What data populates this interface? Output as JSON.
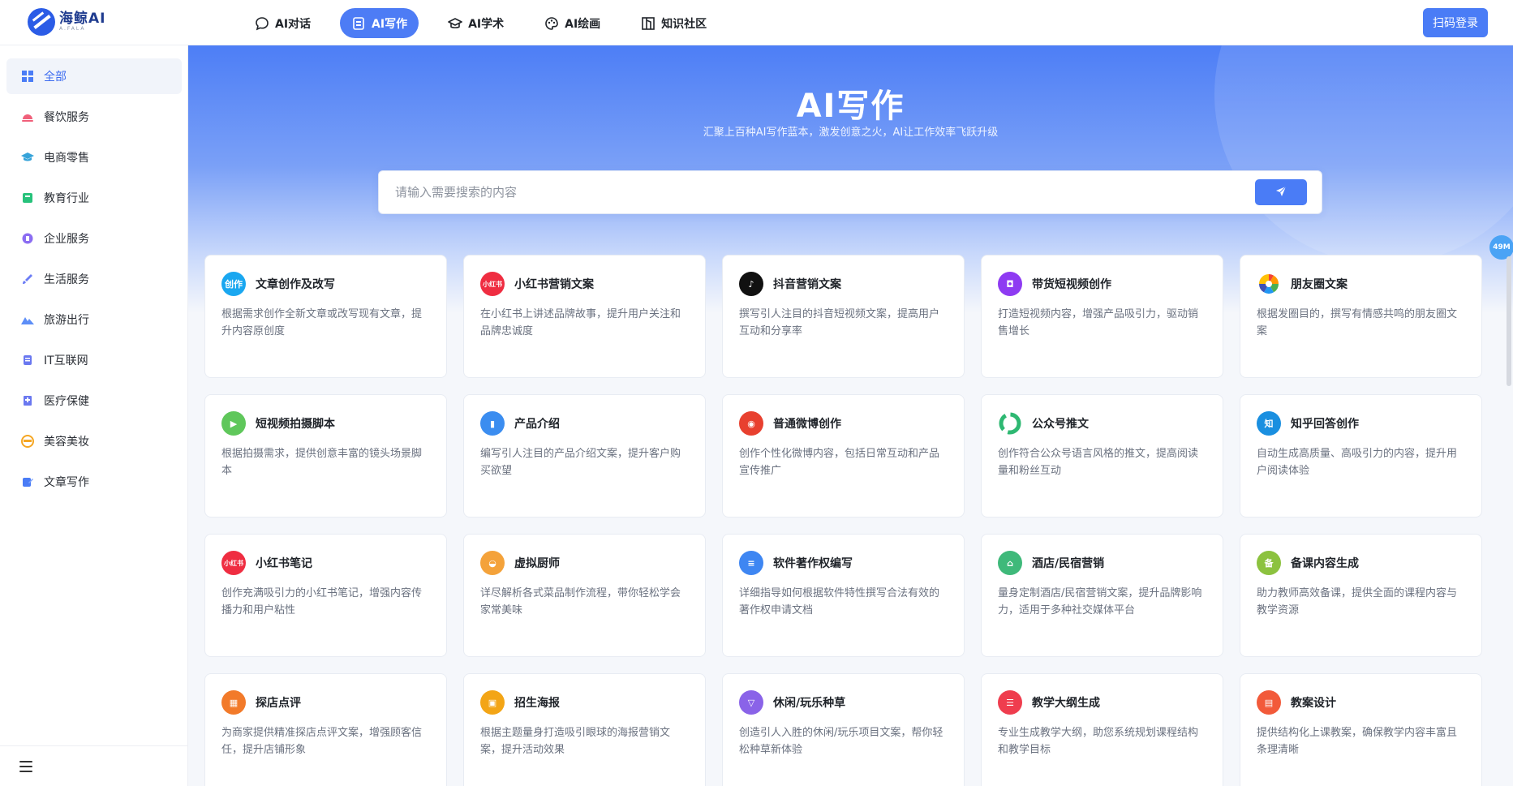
{
  "header": {
    "logo_name": "海鲸AI",
    "logo_sub": "A.FALA",
    "nav": [
      {
        "label": "AI对话",
        "icon": "chat-bubble-icon"
      },
      {
        "label": "AI写作",
        "icon": "document-edit-icon",
        "active": true
      },
      {
        "label": "AI学术",
        "icon": "graduation-cap-icon"
      },
      {
        "label": "AI绘画",
        "icon": "palette-icon"
      },
      {
        "label": "知识社区",
        "icon": "book-icon"
      }
    ],
    "login_label": "扫码登录"
  },
  "sidebar": {
    "items": [
      {
        "label": "全部",
        "icon": "windows-grid-icon",
        "color": "#4a7cf6",
        "active": true
      },
      {
        "label": "餐饮服务",
        "icon": "dining-icon",
        "color": "#f0607a"
      },
      {
        "label": "电商零售",
        "icon": "cap-icon",
        "color": "#36a3d9"
      },
      {
        "label": "教育行业",
        "icon": "book-icon",
        "color": "#27c27b"
      },
      {
        "label": "企业服务",
        "icon": "building-icon",
        "color": "#8b6df2"
      },
      {
        "label": "生活服务",
        "icon": "brush-icon",
        "color": "#6c7df5"
      },
      {
        "label": "旅游出行",
        "icon": "mountain-icon",
        "color": "#5d8ef7"
      },
      {
        "label": "IT互联网",
        "icon": "document-icon",
        "color": "#6a78f0"
      },
      {
        "label": "医疗保健",
        "icon": "clinic-icon",
        "color": "#6a78f0"
      },
      {
        "label": "美容美妆",
        "icon": "face-icon",
        "color": "#f5a623"
      },
      {
        "label": "文章写作",
        "icon": "pencil-note-icon",
        "color": "#4a7cf6"
      }
    ]
  },
  "hero": {
    "title": "AI写作",
    "subtitle": "汇聚上百种AI写作蓝本，激发创意之火，AI让工作效率飞跃升级"
  },
  "search": {
    "placeholder": "请输入需要搜索的内容"
  },
  "badge": "49M",
  "cards": [
    {
      "title": "文章创作及改写",
      "desc": "根据需求创作全新文章或改写现有文章，提升内容原创度",
      "icon": "creation-icon",
      "icon_text": "创作",
      "color": "#1aa7f0"
    },
    {
      "title": "小红书营销文案",
      "desc": "在小红书上讲述品牌故事，提升用户关注和品牌忠诚度",
      "icon": "xiaohongshu-icon",
      "icon_text": "小红书",
      "color": "#ef2d41"
    },
    {
      "title": "抖音营销文案",
      "desc": "撰写引人注目的抖音短视频文案，提高用户互动和分享率",
      "icon": "douyin-icon",
      "icon_text": "♪",
      "color": "#111111"
    },
    {
      "title": "带货短视频创作",
      "desc": "打造短视频内容，增强产品吸引力，驱动销售增长",
      "icon": "shopping-bag-icon",
      "icon_text": "◘",
      "color": "#8e3bf2"
    },
    {
      "title": "朋友圈文案",
      "desc": "根据发圈目的，撰写有情感共鸣的朋友圈文案",
      "icon": "moments-icon",
      "icon_text": "",
      "color": "#ffffff"
    },
    {
      "title": "短视频拍摄脚本",
      "desc": "根据拍摄需求，提供创意丰富的镜头场景脚本",
      "icon": "video-camera-icon",
      "icon_text": "▶",
      "color": "#5fc75b"
    },
    {
      "title": "产品介绍",
      "desc": "编写引人注目的产品介绍文案，提升客户购买欲望",
      "icon": "product-card-icon",
      "icon_text": "▮",
      "color": "#3b8df0"
    },
    {
      "title": "普通微博创作",
      "desc": "创作个性化微博内容，包括日常互动和产品宣传推广",
      "icon": "weibo-icon",
      "icon_text": "◉",
      "color": "#e8402f"
    },
    {
      "title": "公众号推文",
      "desc": "创作符合公众号语言风格的推文，提高阅读量和粉丝互动",
      "icon": "wechat-official-icon",
      "icon_text": "",
      "color": "#ffffff"
    },
    {
      "title": "知乎回答创作",
      "desc": "自动生成高质量、高吸引力的内容，提升用户阅读体验",
      "icon": "zhihu-icon",
      "icon_text": "知",
      "color": "#1a8fe0"
    },
    {
      "title": "小红书笔记",
      "desc": "创作充满吸引力的小红书笔记，增强内容传播力和用户粘性",
      "icon": "xiaohongshu-note-icon",
      "icon_text": "小红书",
      "color": "#ef2d41"
    },
    {
      "title": "虚拟厨师",
      "desc": "详尽解析各式菜品制作流程，带你轻松学会家常美味",
      "icon": "chef-icon",
      "icon_text": "◒",
      "color": "#f4a23a"
    },
    {
      "title": "软件著作权编写",
      "desc": "详细指导如何根据软件特性撰写合法有效的著作权申请文档",
      "icon": "copyright-doc-icon",
      "icon_text": "≡",
      "color": "#3e86f2"
    },
    {
      "title": "酒店/民宿营销",
      "desc": "量身定制酒店/民宿营销文案，提升品牌影响力，适用于多种社交媒体平台",
      "icon": "hotel-icon",
      "icon_text": "⌂",
      "color": "#3fb97a"
    },
    {
      "title": "备课内容生成",
      "desc": "助力教师高效备课，提供全面的课程内容与教学资源",
      "icon": "lesson-prep-icon",
      "icon_text": "备",
      "color": "#8cc23f"
    },
    {
      "title": "探店点评",
      "desc": "为商家提供精准探店点评文案，增强顾客信任，提升店铺形象",
      "icon": "store-review-icon",
      "icon_text": "▦",
      "color": "#f27a2a"
    },
    {
      "title": "招生海报",
      "desc": "根据主题量身打造吸引眼球的海报营销文案，提升活动效果",
      "icon": "poster-icon",
      "icon_text": "▣",
      "color": "#f3a516"
    },
    {
      "title": "休闲/玩乐种草",
      "desc": "创造引人入胜的休闲/玩乐项目文案，帮你轻松种草新体验",
      "icon": "cocktail-icon",
      "icon_text": "▽",
      "color": "#8a63e8"
    },
    {
      "title": "教学大纲生成",
      "desc": "专业生成教学大纲，助您系统规划课程结构和教学目标",
      "icon": "outline-list-icon",
      "icon_text": "☰",
      "color": "#ef3d4e"
    },
    {
      "title": "教案设计",
      "desc": "提供结构化上课教案，确保教学内容丰富且条理清晰",
      "icon": "lesson-plan-icon",
      "icon_text": "▤",
      "color": "#f25a3a"
    }
  ]
}
